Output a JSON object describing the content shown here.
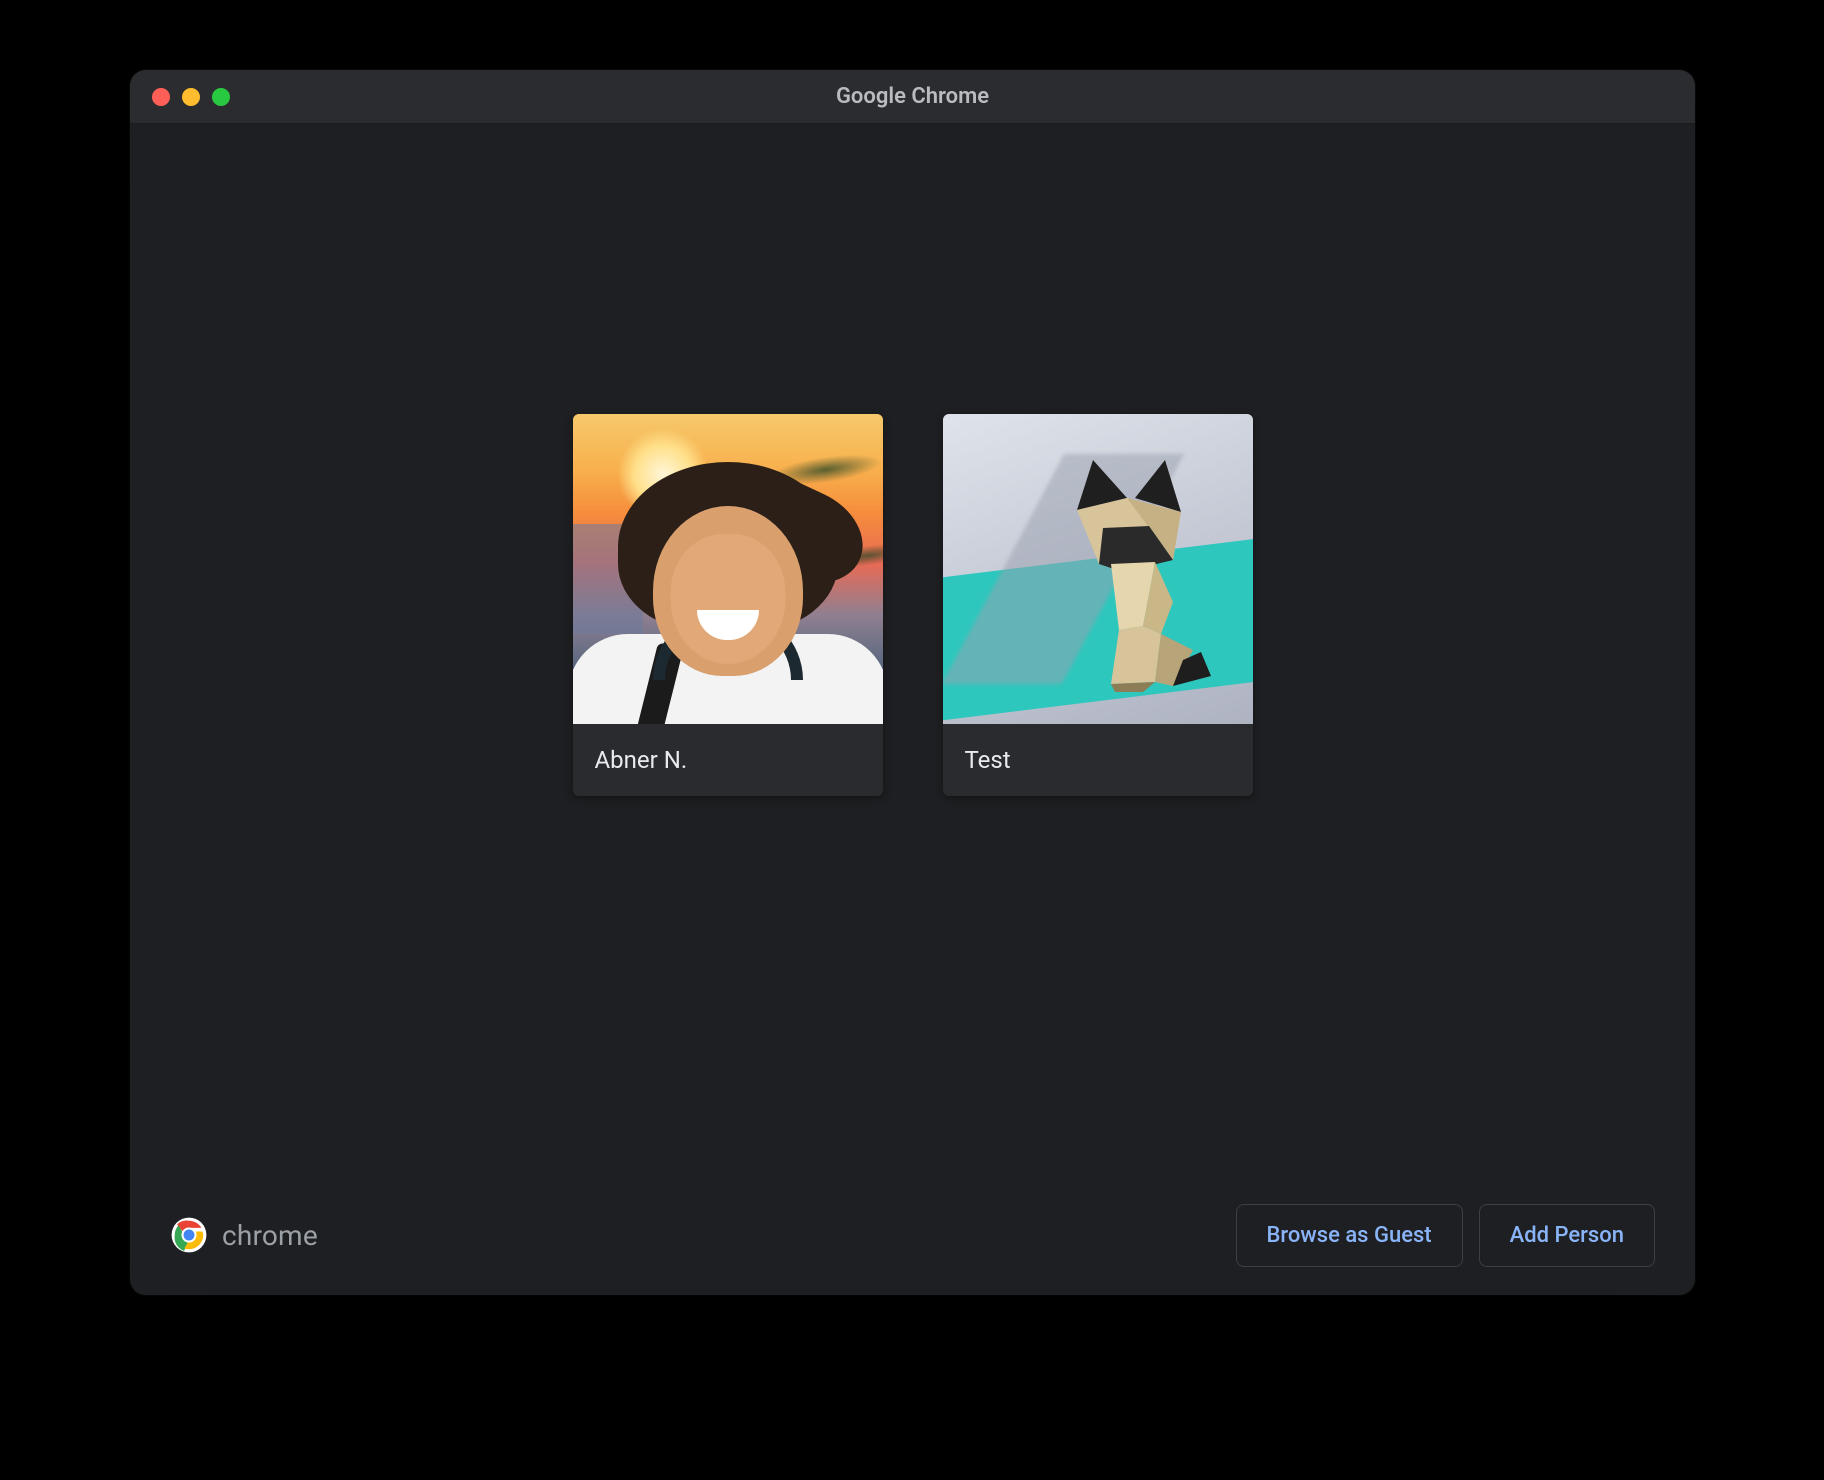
{
  "window": {
    "title": "Google Chrome"
  },
  "profiles": [
    {
      "name": "Abner N.",
      "avatar_kind": "photo-person"
    },
    {
      "name": "Test",
      "avatar_kind": "origami-cat"
    }
  ],
  "footer": {
    "brand_label": "chrome",
    "guest_label": "Browse as Guest",
    "add_label": "Add Person"
  }
}
